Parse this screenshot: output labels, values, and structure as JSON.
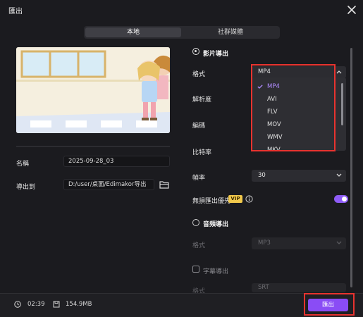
{
  "window": {
    "title": "匯出"
  },
  "tabs": [
    {
      "label": "本地"
    },
    {
      "label": "社群媒體"
    }
  ],
  "left": {
    "name_label": "名稱",
    "name_value": "2025-09-28_03",
    "export_to_label": "導出到",
    "export_to_value": "D:/user/桌面/Edimakor导出"
  },
  "video_export": {
    "heading": "影片導出",
    "format_label": "格式",
    "format_value": "MP4",
    "resolution_label": "解析度",
    "encoding_label": "編碼",
    "bitrate_label": "比特率",
    "framerate_label": "幀率",
    "framerate_value": "30",
    "lossless_label": "無損匯出優先",
    "vip_badge": "VIP"
  },
  "format_dropdown": {
    "options": [
      "MP4",
      "AVI",
      "FLV",
      "MOV",
      "WMV",
      "MKV"
    ],
    "selected": "MP4"
  },
  "audio_export": {
    "heading": "音頻導出",
    "format_label": "格式",
    "format_value": "MP3"
  },
  "subtitle_export": {
    "label": "字幕導出",
    "format_label": "格式",
    "format_value": "SRT"
  },
  "footer": {
    "duration": "02:39",
    "filesize": "154.9MB",
    "export_button": "匯出"
  },
  "colors": {
    "accent": "#8a4cf5",
    "highlight_box": "#e8332f",
    "vip": "#f2c94c"
  }
}
